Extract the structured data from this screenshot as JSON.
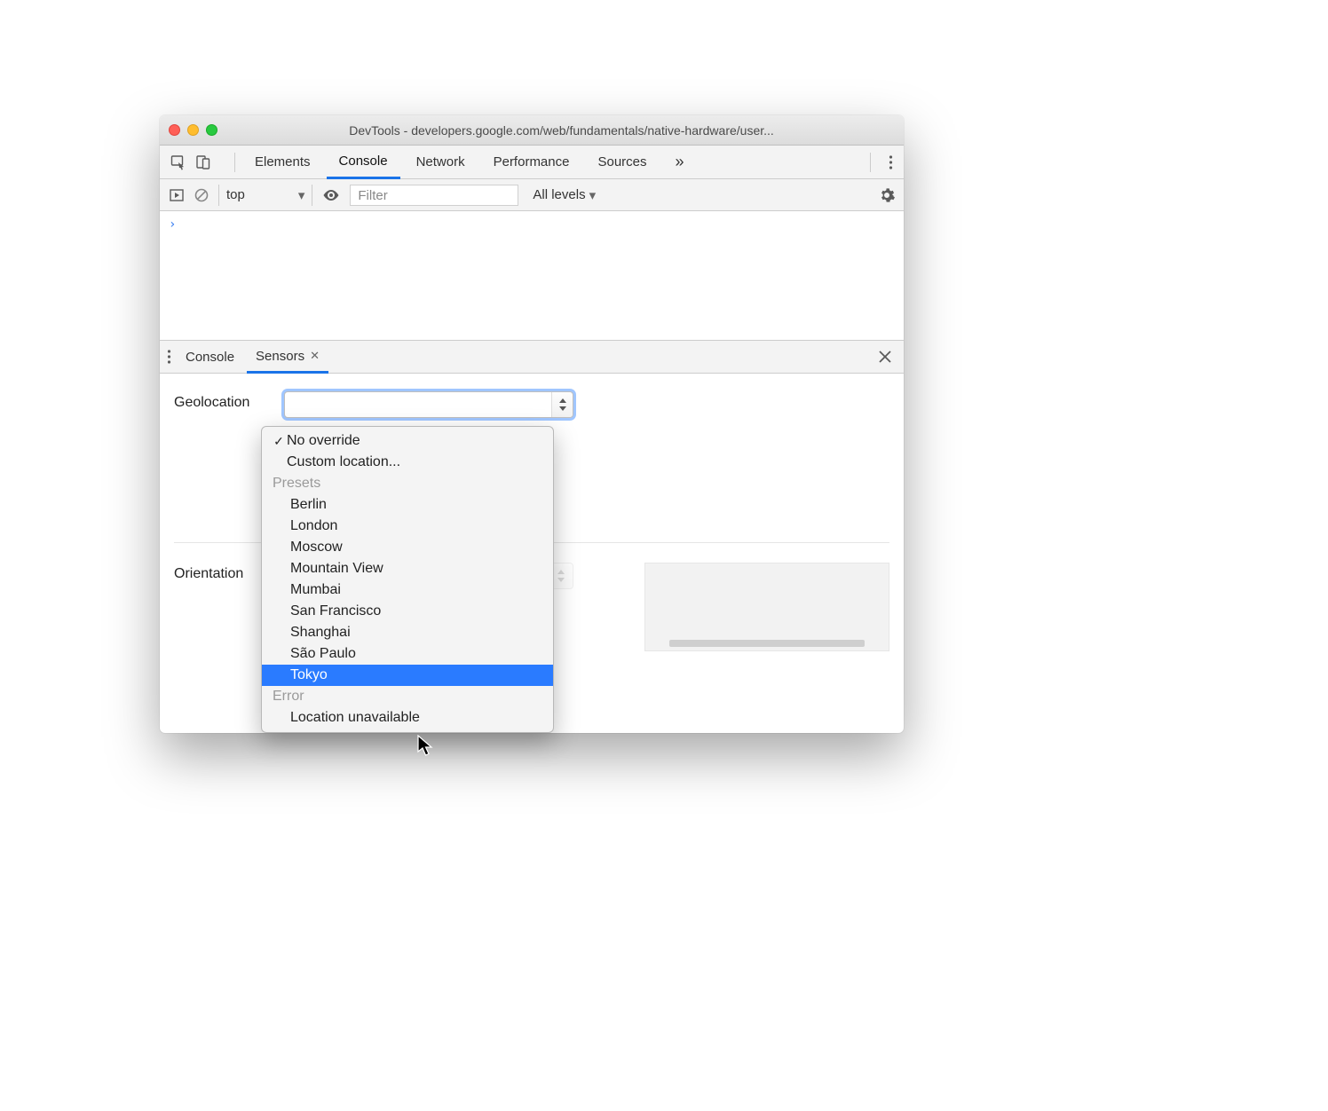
{
  "window": {
    "title": "DevTools - developers.google.com/web/fundamentals/native-hardware/user..."
  },
  "tabs": {
    "items": [
      "Elements",
      "Console",
      "Network",
      "Performance",
      "Sources"
    ],
    "active": "Console",
    "overflow_glyph": "»"
  },
  "console_toolbar": {
    "context": "top",
    "filter_placeholder": "Filter",
    "levels_label": "All levels"
  },
  "console": {
    "prompt": "›"
  },
  "drawer": {
    "tabs": [
      "Console",
      "Sensors"
    ],
    "active": "Sensors"
  },
  "sensors": {
    "geolocation_label": "Geolocation",
    "orientation_label": "Orientation"
  },
  "dropdown": {
    "top": [
      {
        "label": "No override",
        "checked": true
      },
      {
        "label": "Custom location...",
        "checked": false
      }
    ],
    "presets_label": "Presets",
    "presets": [
      "Berlin",
      "London",
      "Moscow",
      "Mountain View",
      "Mumbai",
      "San Francisco",
      "Shanghai",
      "São Paulo",
      "Tokyo"
    ],
    "highlighted": "Tokyo",
    "error_label": "Error",
    "error_items": [
      "Location unavailable"
    ]
  }
}
